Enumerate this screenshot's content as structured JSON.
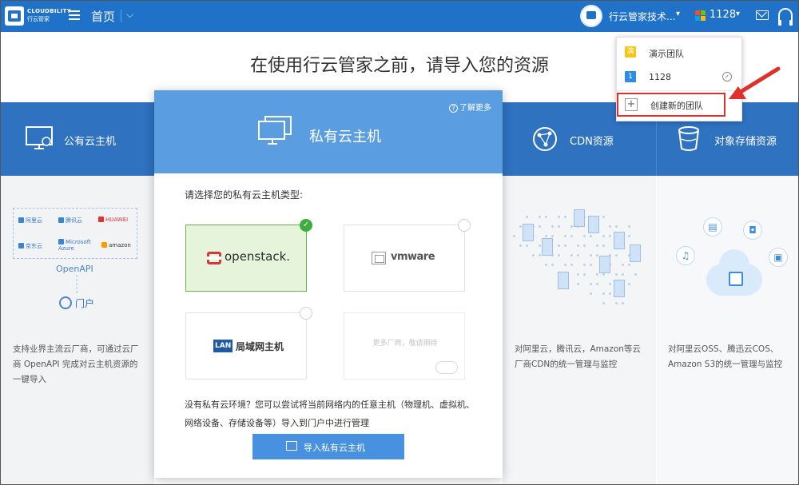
{
  "app": {
    "brand": "CLOUDBILITY",
    "brand_sub": "行云管家",
    "nav_home": "首页",
    "team_name": "行云管家技术...",
    "org_code": "1128"
  },
  "page": {
    "heading": "在使用行云管家之前，请导入您的资源"
  },
  "categories": [
    {
      "label": "公有云主机"
    },
    {
      "label": "CDN资源"
    },
    {
      "label": "对象存储资源"
    }
  ],
  "public_cloud": {
    "vendors": [
      "阿里云",
      "腾讯云",
      "HUAWEI",
      "京东云",
      "Microsoft Azure",
      "amazon"
    ],
    "openapi": "OpenAPI",
    "portal": "门户",
    "desc": "支持业界主流云厂商，可通过云厂商 OpenAPI 完成对云主机资源的一键导入"
  },
  "cdn": {
    "desc": "对阿里云，腾讯云，Amazon等云厂商CDN的统一管理与监控"
  },
  "storage": {
    "desc": "对阿里云OSS、腾迅云COS、Amazon S3的统一管理与监控"
  },
  "modal": {
    "learn_more": "了解更多",
    "title": "私有云主机",
    "prompt": "请选择您的私有云主机类型:",
    "options": [
      {
        "label": "openstack.",
        "selected": true
      },
      {
        "label": "vmware",
        "selected": false
      },
      {
        "badge": "LAN",
        "label": "局域网主机",
        "selected": false
      },
      {
        "label": "更多厂商，敬请期待",
        "selected": false
      }
    ],
    "note": "没有私有云环境？您可以尝试将当前网络内的任意主机（物理机、虚拟机、网络设备、存储设备等）导入到门户中进行管理",
    "import_button": "导入私有云主机"
  },
  "team_dropdown": {
    "items": [
      {
        "badge": "演",
        "badge_color": "#f5c518",
        "label": "演示团队",
        "current": false
      },
      {
        "badge": "1",
        "badge_color": "#2d8ce6",
        "label": "1128",
        "current": true
      }
    ],
    "create_label": "创建新的团队"
  },
  "colors": {
    "topbar": "#1f72c8",
    "band": "#2f72c0",
    "modal_header": "#5b9de1",
    "accent_button": "#4791e0",
    "annotation_red": "#e0302b"
  }
}
